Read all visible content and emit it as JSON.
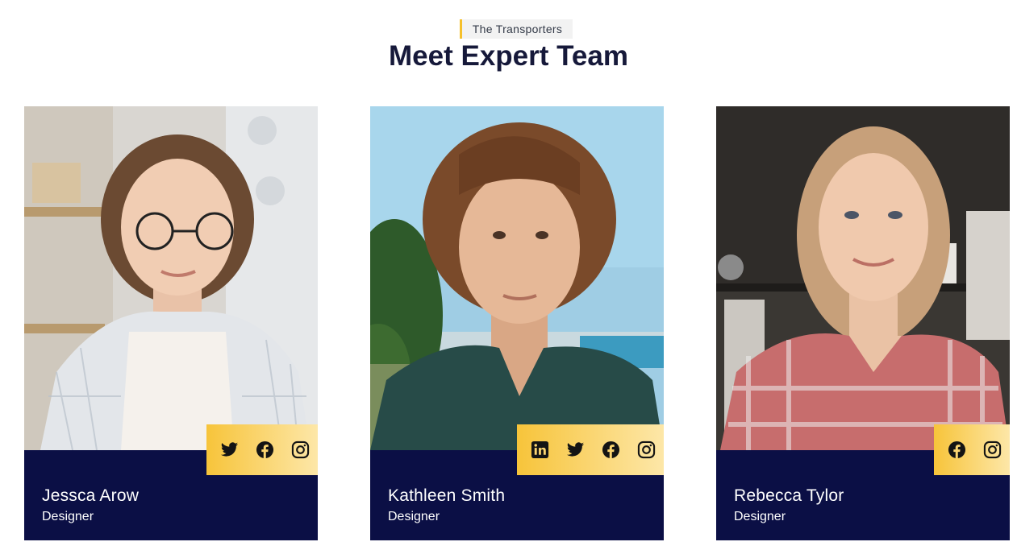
{
  "header": {
    "eyebrow": "The Transporters",
    "title": "Meet Expert Team"
  },
  "colors": {
    "accent": "#f5c02b",
    "card_footer": "#0b0f45",
    "title": "#16193a"
  },
  "team": [
    {
      "name": "Jessca Arow",
      "role": "Designer",
      "social": [
        "twitter-icon",
        "facebook-icon",
        "instagram-icon"
      ]
    },
    {
      "name": "Kathleen Smith",
      "role": "Designer",
      "social": [
        "linkedin-icon",
        "twitter-icon",
        "facebook-icon",
        "instagram-icon"
      ]
    },
    {
      "name": "Rebecca Tylor",
      "role": "Designer",
      "social": [
        "facebook-icon",
        "instagram-icon"
      ]
    }
  ]
}
